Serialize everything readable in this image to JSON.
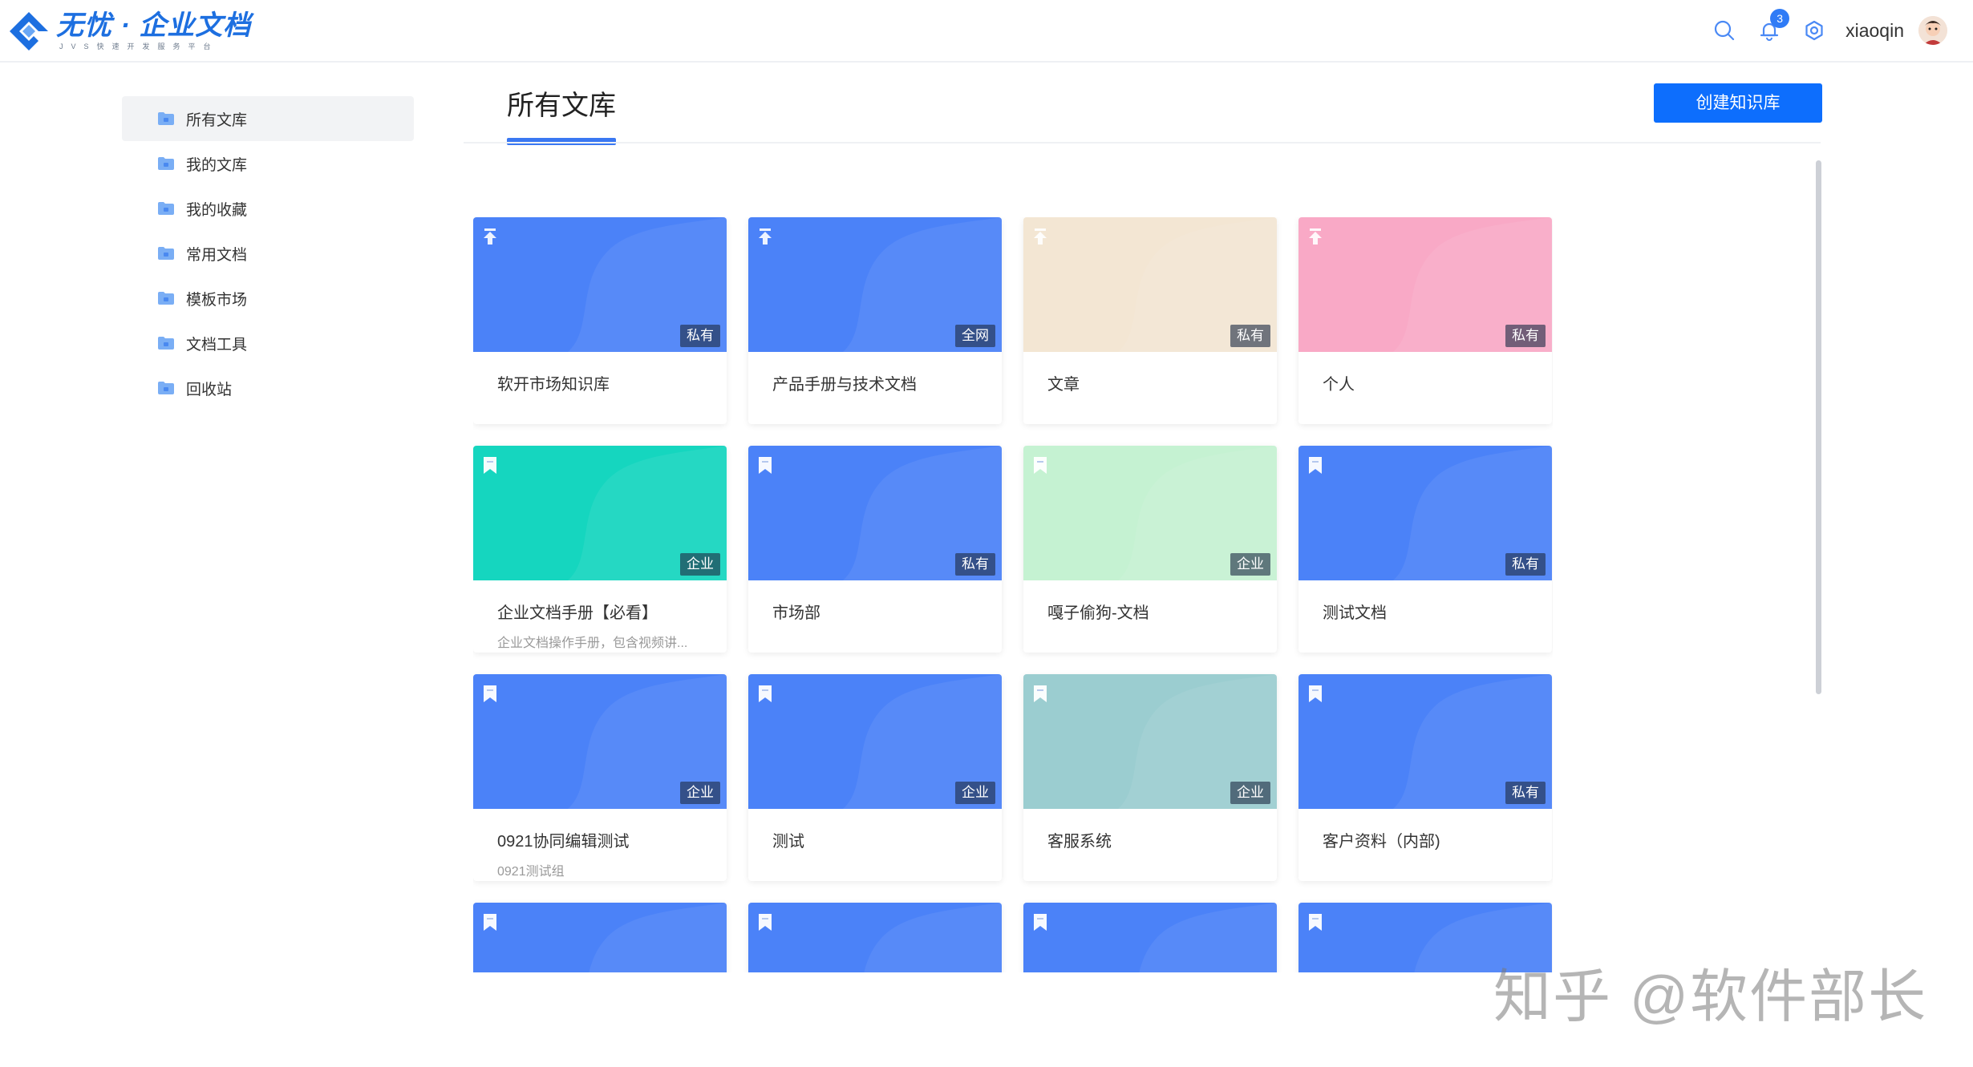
{
  "header": {
    "logo_title": "无忧 · 企业文档",
    "logo_subtitle": "JVS快速开发服务平台",
    "notification_count": "3",
    "username": "xiaoqin"
  },
  "sidebar": {
    "items": [
      {
        "label": "所有文库",
        "active": true
      },
      {
        "label": "我的文库",
        "active": false
      },
      {
        "label": "我的收藏",
        "active": false
      },
      {
        "label": "常用文档",
        "active": false
      },
      {
        "label": "模板市场",
        "active": false
      },
      {
        "label": "文档工具",
        "active": false
      },
      {
        "label": "回收站",
        "active": false
      }
    ]
  },
  "main": {
    "title": "所有文库",
    "create_button": "创建知识库"
  },
  "cards": [
    {
      "name": "软开市场知识库",
      "desc": "",
      "tag": "私有",
      "color": "#4b82f8",
      "icon": "pin-icon"
    },
    {
      "name": "产品手册与技术文档",
      "desc": "",
      "tag": "全网",
      "color": "#4b82f8",
      "icon": "pin-icon"
    },
    {
      "name": "文章",
      "desc": "",
      "tag": "私有",
      "color": "#f3e6d3",
      "icon": "pin-icon"
    },
    {
      "name": "个人",
      "desc": "",
      "tag": "私有",
      "color": "#f9a9c6",
      "icon": "pin-icon"
    },
    {
      "name": "企业文档手册【必看】",
      "desc": "企业文档操作手册，包含视频讲...",
      "tag": "企业",
      "color": "#15d6bf",
      "icon": "bookmark-icon"
    },
    {
      "name": "市场部",
      "desc": "",
      "tag": "私有",
      "color": "#4b82f8",
      "icon": "bookmark-icon"
    },
    {
      "name": "嘎子偷狗-文档",
      "desc": "",
      "tag": "企业",
      "color": "#c5f2d2",
      "icon": "bookmark-icon"
    },
    {
      "name": "测试文档",
      "desc": "",
      "tag": "私有",
      "color": "#4b82f8",
      "icon": "bookmark-icon"
    },
    {
      "name": "0921协同编辑测试",
      "desc": "0921测试组",
      "tag": "企业",
      "color": "#4b82f8",
      "icon": "bookmark-icon"
    },
    {
      "name": "测试",
      "desc": "",
      "tag": "企业",
      "color": "#4b82f8",
      "icon": "bookmark-icon"
    },
    {
      "name": "客服系统",
      "desc": "",
      "tag": "企业",
      "color": "#9bcdd0",
      "icon": "bookmark-icon"
    },
    {
      "name": "客户资料（内部)",
      "desc": "",
      "tag": "私有",
      "color": "#4b82f8",
      "icon": "bookmark-icon"
    },
    {
      "name": "",
      "desc": "",
      "tag": "",
      "color": "#4b82f8",
      "icon": "bookmark-icon"
    },
    {
      "name": "",
      "desc": "",
      "tag": "",
      "color": "#4b82f8",
      "icon": "bookmark-icon"
    },
    {
      "name": "",
      "desc": "",
      "tag": "",
      "color": "#4b82f8",
      "icon": "bookmark-icon"
    },
    {
      "name": "",
      "desc": "",
      "tag": "",
      "color": "#4b82f8",
      "icon": "bookmark-icon"
    }
  ],
  "watermark": "知乎 @软件部长"
}
